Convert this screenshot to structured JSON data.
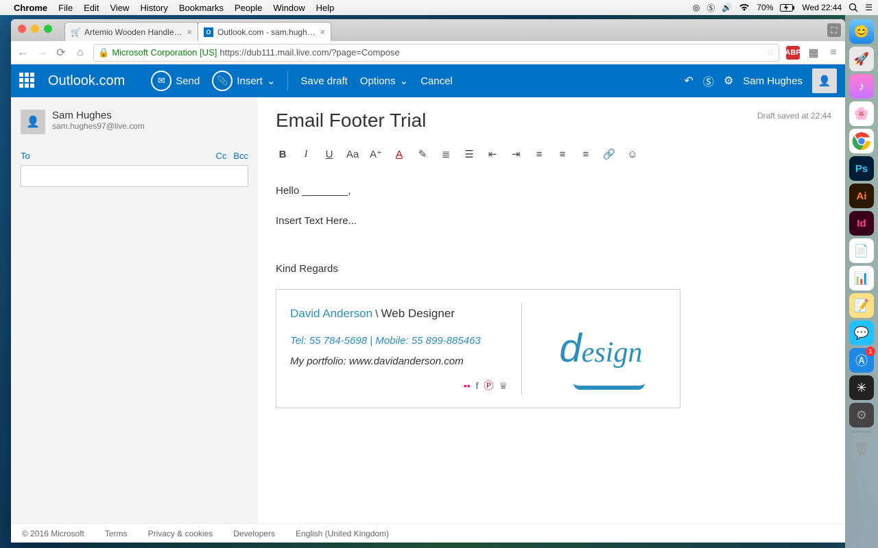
{
  "menubar": {
    "app": "Chrome",
    "items": [
      "File",
      "Edit",
      "View",
      "History",
      "Bookmarks",
      "People",
      "Window",
      "Help"
    ],
    "right": {
      "battery": "70%",
      "clock": "Wed 22:44"
    }
  },
  "chrome": {
    "tabs": [
      {
        "title": "Artemio Wooden Handle F…"
      },
      {
        "title": "Outlook.com - sam.hughes…"
      }
    ],
    "url_org": "Microsoft Corporation [US]",
    "url_path": "https://dub111.mail.live.com/?page=Compose"
  },
  "outlook": {
    "brand": "Outlook.com",
    "actions": {
      "send": "Send",
      "insert": "Insert",
      "save_draft": "Save draft",
      "options": "Options",
      "cancel": "Cancel"
    },
    "user_name": "Sam Hughes",
    "from": {
      "name": "Sam Hughes",
      "email": "sam.hughes97@live.com"
    },
    "fields": {
      "to": "To",
      "cc": "Cc",
      "bcc": "Bcc"
    },
    "subject": "Email Footer Trial",
    "draft_saved": "Draft saved at 22:44",
    "body": {
      "line1": "Hello ________,",
      "line2": "Insert Text Here...",
      "line3": "Kind Regards"
    },
    "signature": {
      "name": "David Anderson",
      "sep": "\\",
      "role": "Web Designer",
      "tel_label": "Tel:",
      "tel": "55 784-5698",
      "mobile_label": "Mobile:",
      "mobile": "55 899-885463",
      "portfolio_label": "My portfolio:",
      "portfolio": "www.davidanderson.com",
      "logo_text": "design"
    }
  },
  "footer": {
    "copyright": "© 2016 Microsoft",
    "links": [
      "Terms",
      "Privacy & cookies",
      "Developers",
      "English (United Kingdom)"
    ]
  }
}
